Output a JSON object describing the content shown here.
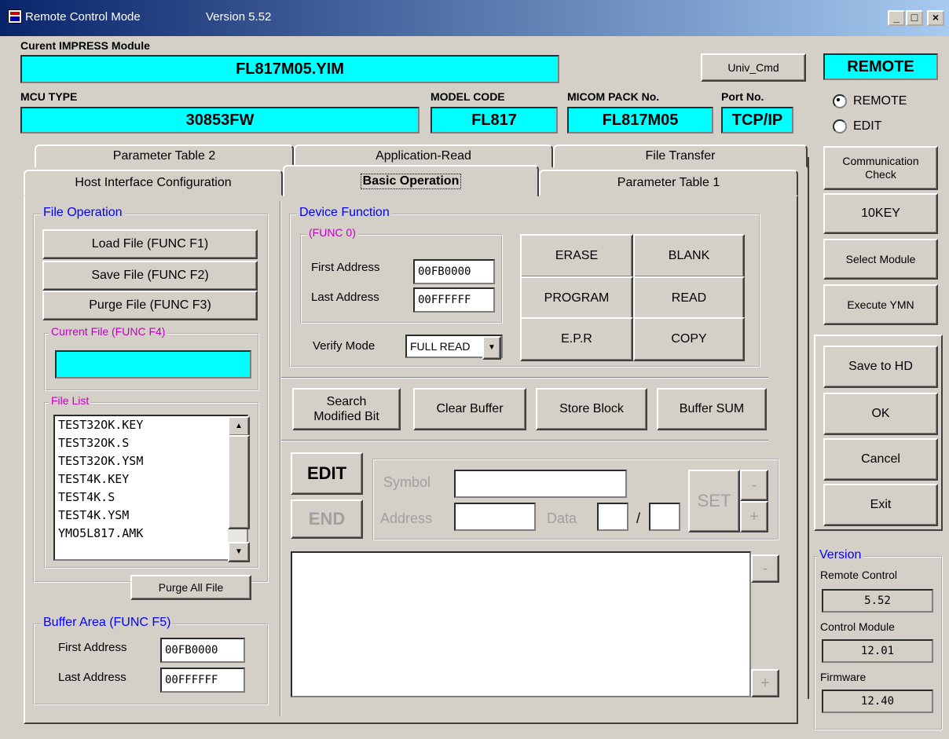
{
  "window": {
    "title": "Remote Control Mode",
    "version_label": "Version  5.52",
    "min": "_",
    "max": "□",
    "close": "×"
  },
  "module": {
    "label": "Curent IMPRESS Module",
    "value": "FL817M05.YIM"
  },
  "univ_cmd": "Univ_Cmd",
  "mode_badge": "REMOTE",
  "mcu": {
    "label": "MCU TYPE",
    "value": "30853FW"
  },
  "model": {
    "label": "MODEL CODE",
    "value": "FL817"
  },
  "micom": {
    "label": "MICOM PACK No.",
    "value": "FL817M05"
  },
  "port": {
    "label": "Port No.",
    "value": "TCP/IP"
  },
  "mode_radios": [
    {
      "label": "REMOTE",
      "checked": true
    },
    {
      "label": "EDIT",
      "checked": false
    }
  ],
  "tabs_back": [
    "Parameter Table 2",
    "Application-Read",
    "File Transfer"
  ],
  "tabs_front": [
    "Host Interface Configuration",
    "Basic Operation",
    "Parameter Table 1"
  ],
  "file_op": {
    "label": "File Operation",
    "load": "Load File  (FUNC F1)",
    "save": "Save File  (FUNC F2)",
    "purge": "Purge File (FUNC F3)",
    "current_label": "Current File (FUNC F4)",
    "current_value": "",
    "list_label": "File List",
    "files": [
      "TEST32OK.KEY",
      "TEST32OK.S",
      "TEST32OK.YSM",
      "TEST4K.KEY",
      "TEST4K.S",
      "TEST4K.YSM",
      "YMO5L817.AMK"
    ],
    "purge_all": "Purge All File"
  },
  "buffer_area": {
    "label": "Buffer Area (FUNC F5)",
    "first_label": "First  Address",
    "first_value": "00FB0000",
    "last_label": "Last  Address",
    "last_value": "00FFFFFF"
  },
  "device": {
    "label": "Device Function",
    "func0_label": "(FUNC 0)",
    "first_label": "First  Address",
    "first_value": "00FB0000",
    "last_label": "Last  Address",
    "last_value": "00FFFFFF",
    "verify_label": "Verify Mode",
    "verify_value": "FULL READ",
    "ops": [
      "ERASE",
      "BLANK",
      "PROGRAM",
      "READ",
      "E.P.R",
      "COPY"
    ]
  },
  "buffer_btns": {
    "search": "Search\nModified Bit",
    "clear": "Clear Buffer",
    "store": "Store Block",
    "sum": "Buffer SUM"
  },
  "edit_area": {
    "edit": "EDIT",
    "end": "END",
    "symbol": "Symbol",
    "address": "Address",
    "data": "Data",
    "slash": "/",
    "set": "SET",
    "minus": "-",
    "plus": "+"
  },
  "right_btns": [
    "Communication\nCheck",
    "10KEY",
    "Select Module",
    "Execute YMN"
  ],
  "right_btns2": [
    "Save to HD",
    "OK",
    "Cancel",
    "Exit"
  ],
  "version_panel": {
    "label": "Version",
    "remote_label": "Remote Control",
    "remote_value": "5.52",
    "control_label": "Control Module",
    "control_value": "12.01",
    "firmware_label": "Firmware",
    "firmware_value": "12.40"
  }
}
